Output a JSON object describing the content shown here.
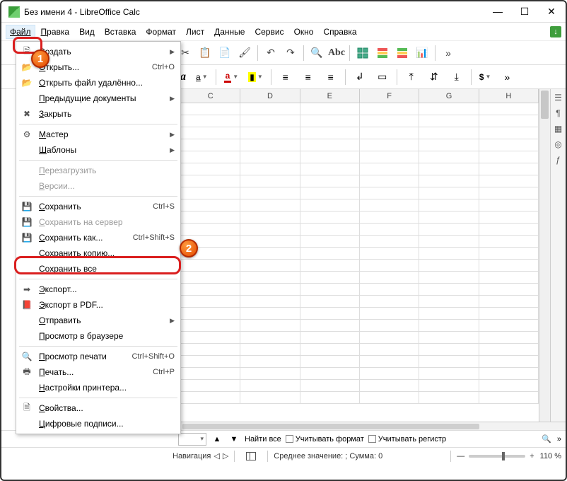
{
  "title": "Без имени 4 - LibreOffice Calc",
  "menus": {
    "file": "Файл",
    "edit": "Правка",
    "view": "Вид",
    "insert": "Вставка",
    "format": "Формат",
    "sheet": "Лист",
    "data": "Данные",
    "tools": "Сервис",
    "window": "Окно",
    "help": "Справка"
  },
  "file_menu": [
    {
      "icon": "doc-new",
      "label": "Создать",
      "shortcut": "",
      "sub": true
    },
    {
      "icon": "open",
      "label": "Открыть...",
      "shortcut": "Ctrl+O"
    },
    {
      "icon": "open-remote",
      "label": "Открыть файл удалённо..."
    },
    {
      "icon": "",
      "label": "Предыдущие документы",
      "sub": true
    },
    {
      "icon": "close",
      "label": "Закрыть"
    },
    {
      "sep": true
    },
    {
      "icon": "wizard",
      "label": "Мастер",
      "sub": true
    },
    {
      "icon": "",
      "label": "Шаблоны",
      "sub": true
    },
    {
      "sep": true
    },
    {
      "icon": "",
      "label": "Перезагрузить",
      "disabled": true
    },
    {
      "icon": "",
      "label": "Версии...",
      "disabled": true
    },
    {
      "sep": true
    },
    {
      "icon": "save",
      "label": "Сохранить",
      "shortcut": "Ctrl+S"
    },
    {
      "icon": "save-remote",
      "label": "Сохранить на сервер",
      "disabled": true
    },
    {
      "icon": "save-as",
      "label": "Сохранить как...",
      "shortcut": "Ctrl+Shift+S",
      "highlight": true
    },
    {
      "icon": "",
      "label": "Сохранить копию..."
    },
    {
      "icon": "",
      "label": "Сохранить все"
    },
    {
      "sep": true
    },
    {
      "icon": "export",
      "label": "Экспорт..."
    },
    {
      "icon": "pdf",
      "label": "Экспорт в PDF..."
    },
    {
      "icon": "",
      "label": "Отправить",
      "sub": true
    },
    {
      "icon": "",
      "label": "Просмотр в браузере"
    },
    {
      "sep": true
    },
    {
      "icon": "preview",
      "label": "Просмотр печати",
      "shortcut": "Ctrl+Shift+O"
    },
    {
      "icon": "print",
      "label": "Печать...",
      "shortcut": "Ctrl+P"
    },
    {
      "icon": "",
      "label": "Настройки принтера..."
    },
    {
      "sep": true
    },
    {
      "icon": "props",
      "label": "Свойства..."
    },
    {
      "icon": "",
      "label": "Цифровые подписи..."
    }
  ],
  "columns": [
    "C",
    "D",
    "E",
    "F",
    "G",
    "H"
  ],
  "findbar": {
    "find_all": "Найти все",
    "match_format": "Учитывать формат",
    "match_case": "Учитывать регистр"
  },
  "status": {
    "nav": "Навигация",
    "avg_sum": "Среднее значение: ; Сумма: 0",
    "zoom": "110 %"
  },
  "callouts": {
    "c1": "1",
    "c2": "2"
  }
}
